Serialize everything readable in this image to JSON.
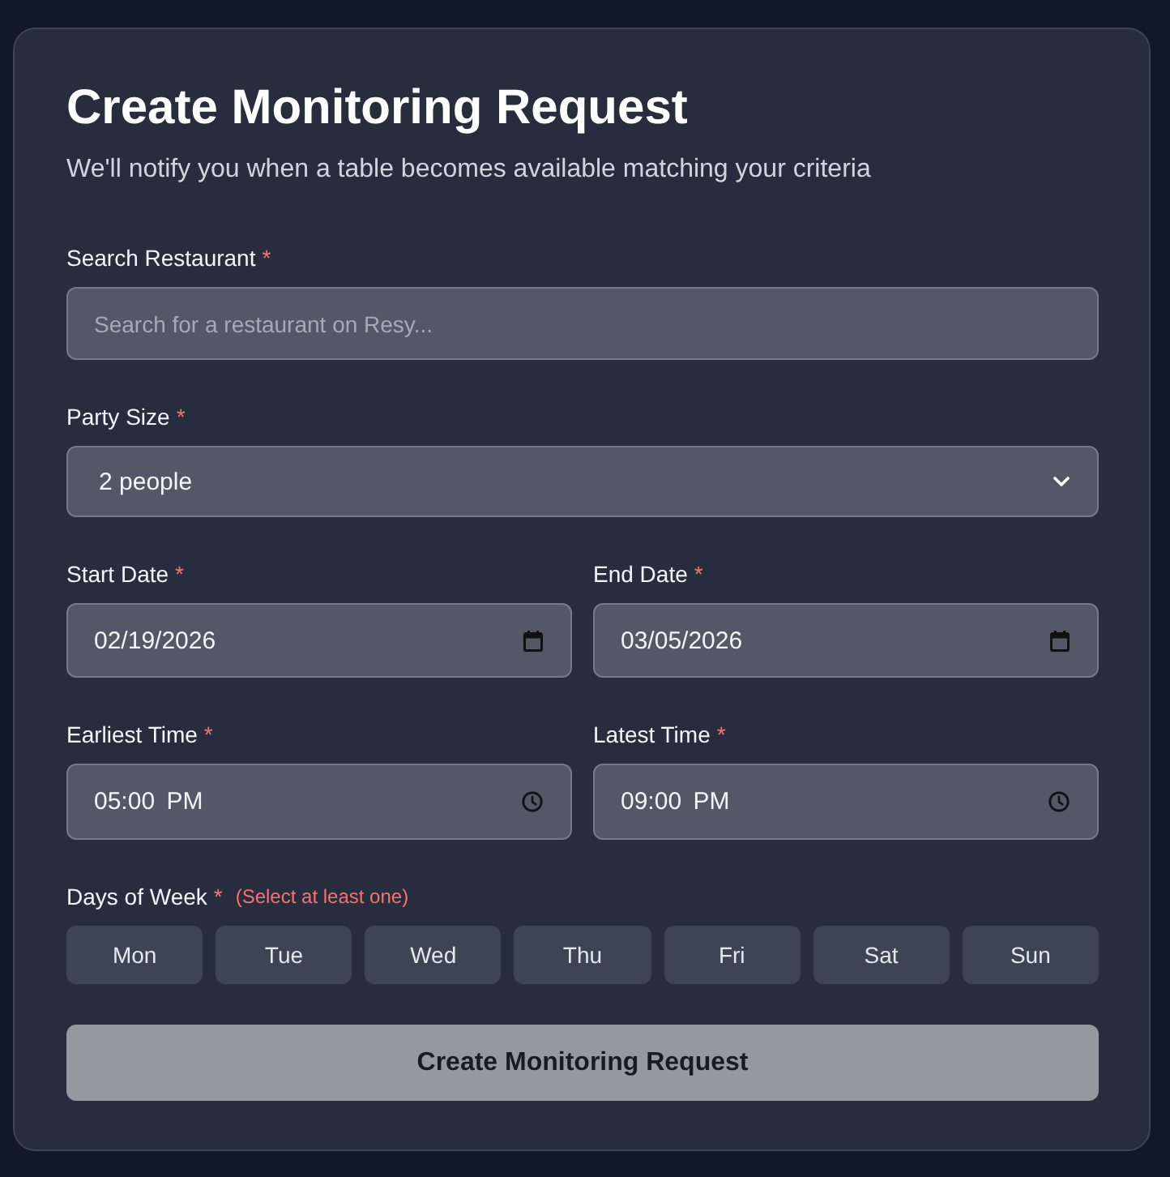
{
  "title": "Create Monitoring Request",
  "subtitle": "We'll notify you when a table becomes available matching your criteria",
  "rows": [
    [
      {
        "kind": "search",
        "label": "Search Restaurant",
        "required_mark": "*",
        "placeholder": "Search for a restaurant on Resy..."
      }
    ],
    [
      {
        "kind": "select",
        "label": "Party Size",
        "required_mark": "*",
        "value": "2 people"
      }
    ],
    [
      {
        "kind": "date",
        "label": "Start Date",
        "required_mark": "*",
        "value": "02/19/2026"
      },
      {
        "kind": "date",
        "label": "End Date",
        "required_mark": "*",
        "value": "03/05/2026"
      }
    ],
    [
      {
        "kind": "time",
        "label": "Earliest Time",
        "required_mark": "*",
        "value": "05:00 PM"
      },
      {
        "kind": "time",
        "label": "Latest Time",
        "required_mark": "*",
        "value": "09:00 PM"
      }
    ]
  ],
  "days_of_week": {
    "label": "Days of Week",
    "required_mark": "*",
    "hint": "(Select at least one)",
    "days": [
      {
        "label": "Mon",
        "selected": false
      },
      {
        "label": "Tue",
        "selected": false
      },
      {
        "label": "Wed",
        "selected": false
      },
      {
        "label": "Thu",
        "selected": false
      },
      {
        "label": "Fri",
        "selected": false
      },
      {
        "label": "Sat",
        "selected": false
      },
      {
        "label": "Sun",
        "selected": false
      }
    ]
  },
  "submit_button": {
    "label": "Create Monitoring Request",
    "disabled": true
  }
}
